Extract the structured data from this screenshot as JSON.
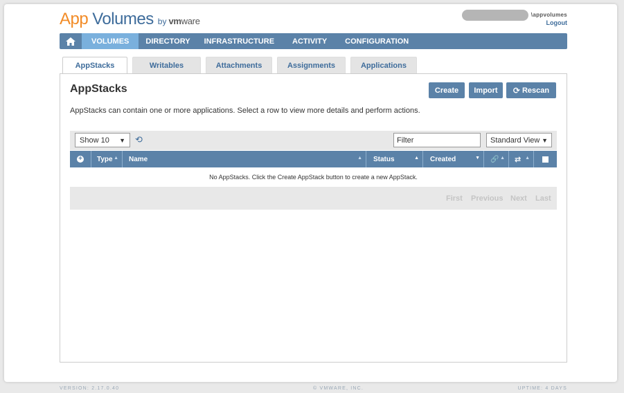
{
  "brand": {
    "app": "App",
    "volumes": "Volumes",
    "by": "by",
    "vm": "vm",
    "ware": "ware"
  },
  "user": {
    "name": "\\appvolumes",
    "logout": "Logout"
  },
  "nav": {
    "items": [
      "VOLUMES",
      "DIRECTORY",
      "INFRASTRUCTURE",
      "ACTIVITY",
      "CONFIGURATION"
    ],
    "active": "VOLUMES"
  },
  "tabs": [
    "AppStacks",
    "Writables",
    "Attachments",
    "Assignments",
    "Applications"
  ],
  "panel": {
    "title": "AppStacks",
    "description": "AppStacks can contain one or more applications. Select a row to view more details and perform actions.",
    "buttons": {
      "create": "Create",
      "import": "Import",
      "rescan": "Rescan"
    }
  },
  "toolbar": {
    "show": "Show 10",
    "filter_placeholder": "Filter",
    "view": "Standard View"
  },
  "table": {
    "columns": [
      "Type",
      "Name",
      "Status",
      "Created"
    ],
    "empty_message": "No AppStacks. Click the Create AppStack button to create a new AppStack."
  },
  "pager": {
    "first": "First",
    "previous": "Previous",
    "next": "Next",
    "last": "Last"
  },
  "footer": {
    "version": "VERSION: 2.17.0.40",
    "copyright": "© VMWARE, INC.",
    "uptime": "UPTIME: 4 DAYS"
  },
  "colors": {
    "accent": "#5b82a8",
    "active_nav": "#7ab0dd",
    "logo_orange": "#f28c28"
  }
}
